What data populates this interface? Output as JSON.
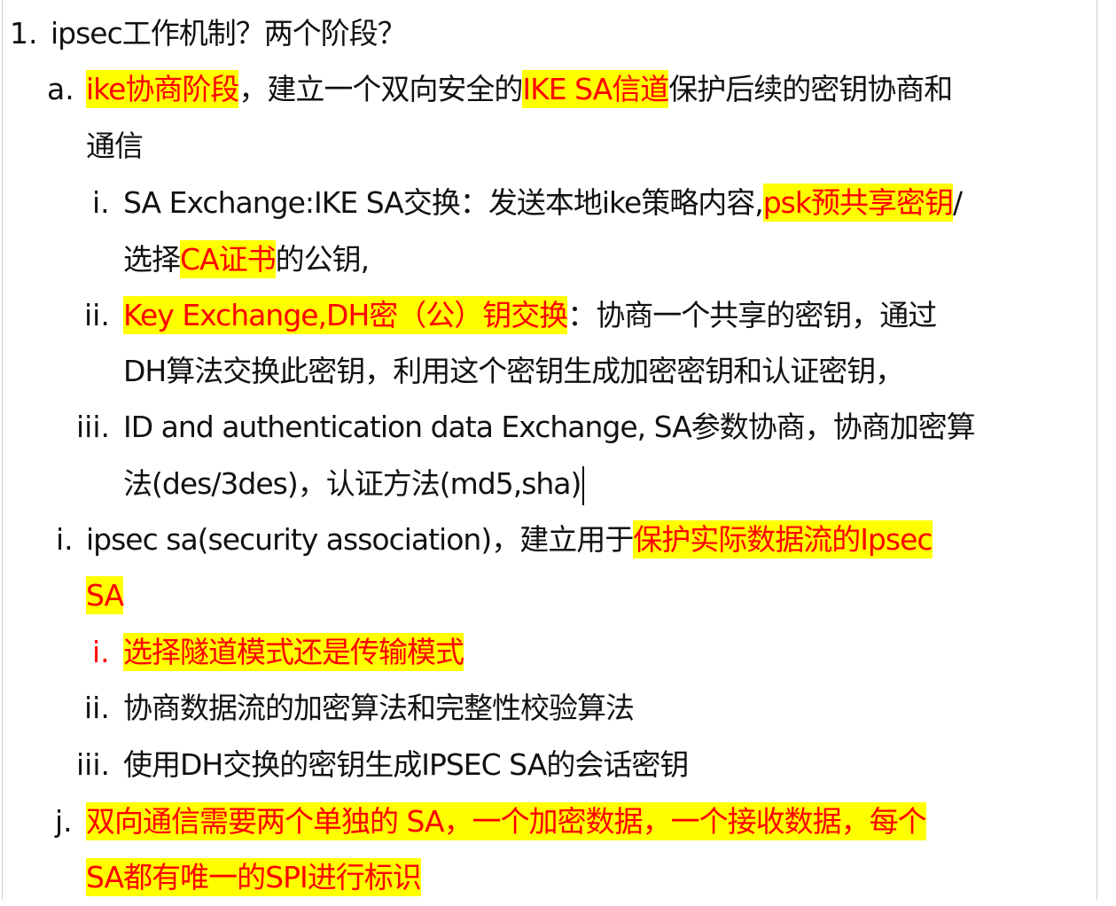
{
  "item_1": {
    "marker": "1.",
    "text": "ipsec工作机制？两个阶段？"
  },
  "item_a": {
    "marker": "a.",
    "line1": {
      "hl1": "ike协商阶段",
      "t1": "，建立一个双向安全的",
      "hl2": "IKE SA信道",
      "t2": "保护后续的密钥协商和"
    },
    "line2": {
      "t1": "通信"
    }
  },
  "item_a_i": {
    "marker": "i.",
    "line1": {
      "t1": "SA Exchange:IKE SA交换：发送本地ike策略内容,",
      "hl1": "psk预共享密钥",
      "t2": "/"
    },
    "line2": {
      "t1": "选择",
      "hl1": "CA证书",
      "t2": "的公钥,"
    }
  },
  "item_a_ii": {
    "marker": "ii.",
    "line1": {
      "hl1": "Key Exchange,DH密（公）钥交换",
      "t1": "：协商一个共享的密钥，通过"
    },
    "line2": {
      "t1": "DH算法交换此密钥，利用这个密钥生成加密密钥和认证密钥，"
    }
  },
  "item_a_iii": {
    "marker": "iii.",
    "line1": {
      "t1": "ID and authentication data Exchange, SA参数协商，协商加密算"
    },
    "line2": {
      "t1": "法(des/3des)，认证方法(md5,sha)"
    }
  },
  "item_i": {
    "marker": "i.",
    "line1": {
      "t1": "ipsec sa(security association)，建立用于",
      "hl1": "保护实际数据流的Ipsec "
    },
    "line2": {
      "hl1": "SA"
    }
  },
  "item_i_i": {
    "marker": "i.",
    "line1": {
      "hl1": "选择隧道模式还是传输模式"
    }
  },
  "item_i_ii": {
    "marker": "ii.",
    "line1": {
      "t1": "协商数据流的加密算法和完整性校验算法"
    }
  },
  "item_i_iii": {
    "marker": "iii.",
    "line1": {
      "t1": "使用DH交换的密钥生成IPSEC SA的会话密钥"
    }
  },
  "item_j": {
    "marker": "j.",
    "line1": {
      "hl1": "双向通信需要两个单独的 SA，一个加密数据，一个接收数据，每个"
    },
    "line2": {
      "hl1": "SA都有唯一的SPI进行标识"
    }
  },
  "colors": {
    "highlight": "#ffff00",
    "accent_text": "#ff0000",
    "body_text": "#111111"
  }
}
